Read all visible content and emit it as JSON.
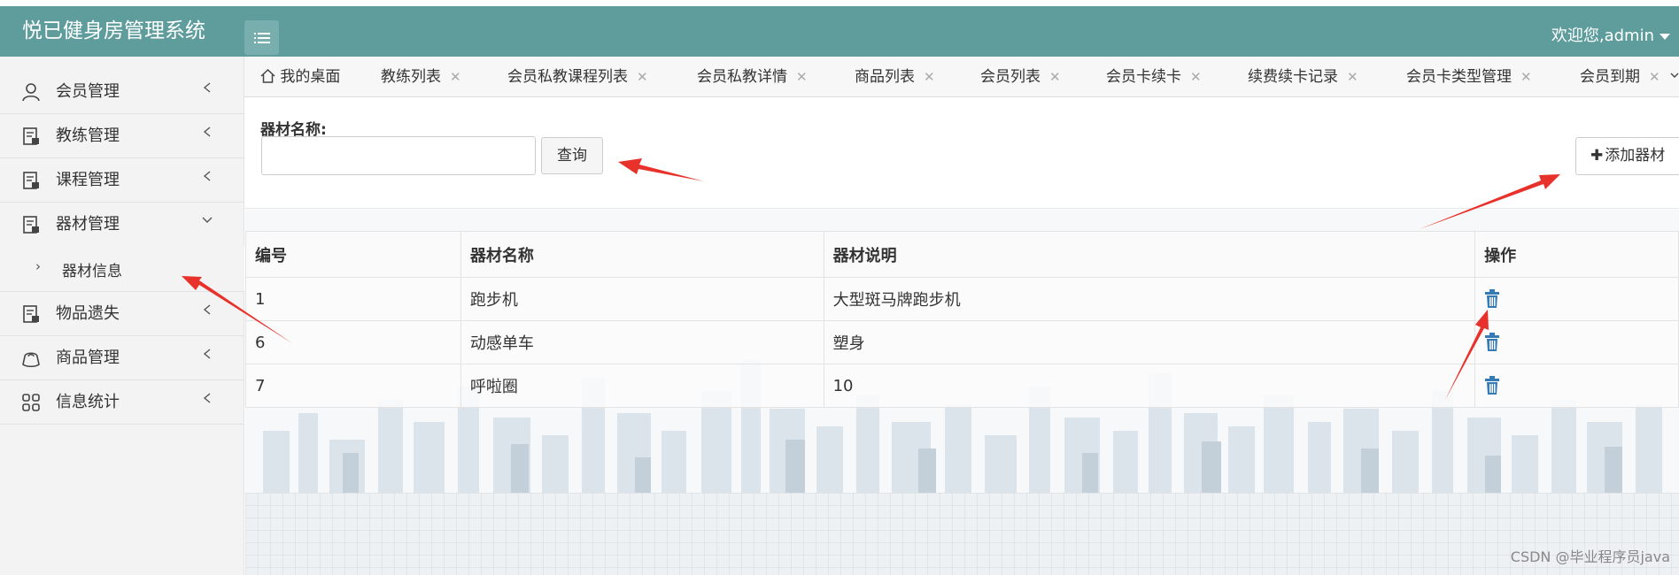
{
  "app": {
    "title": "悦已健身房管理系统",
    "user_label": "欢迎您,admin"
  },
  "sidebar": {
    "items": [
      {
        "label": "会员管理",
        "icon": "user-icon"
      },
      {
        "label": "教练管理",
        "icon": "document-icon"
      },
      {
        "label": "课程管理",
        "icon": "document-icon"
      },
      {
        "label": "器材管理",
        "icon": "document-icon",
        "expanded": true
      },
      {
        "label": "物品遗失",
        "icon": "document-icon"
      },
      {
        "label": "商品管理",
        "icon": "bag-icon"
      },
      {
        "label": "信息统计",
        "icon": "grid-icon"
      }
    ],
    "sub_items": [
      {
        "label": "器材信息"
      }
    ]
  },
  "tabs": [
    {
      "label": "我的桌面",
      "icon": "home-icon"
    },
    {
      "label": "教练列表"
    },
    {
      "label": "会员私教课程列表"
    },
    {
      "label": "会员私教详情"
    },
    {
      "label": "商品列表"
    },
    {
      "label": "会员列表"
    },
    {
      "label": "会员卡续卡"
    },
    {
      "label": "续费续卡记录"
    },
    {
      "label": "会员卡类型管理"
    },
    {
      "label": "会员到期"
    }
  ],
  "search": {
    "label": "器材名称:",
    "value": "",
    "query_button": "查询",
    "add_button": "添加器材"
  },
  "table": {
    "headers": [
      "编号",
      "器材名称",
      "器材说明",
      "操作"
    ],
    "rows": [
      {
        "id": "1",
        "name": "跑步机",
        "desc": "大型斑马牌跑步机"
      },
      {
        "id": "6",
        "name": "动感单车",
        "desc": "塑身"
      },
      {
        "id": "7",
        "name": "呼啦圈",
        "desc": "10"
      }
    ]
  },
  "watermark": "CSDN @毕业程序员java",
  "colors": {
    "header": "#5f9c9c",
    "accent": "#337ab7",
    "annotation": "#e8312a"
  }
}
